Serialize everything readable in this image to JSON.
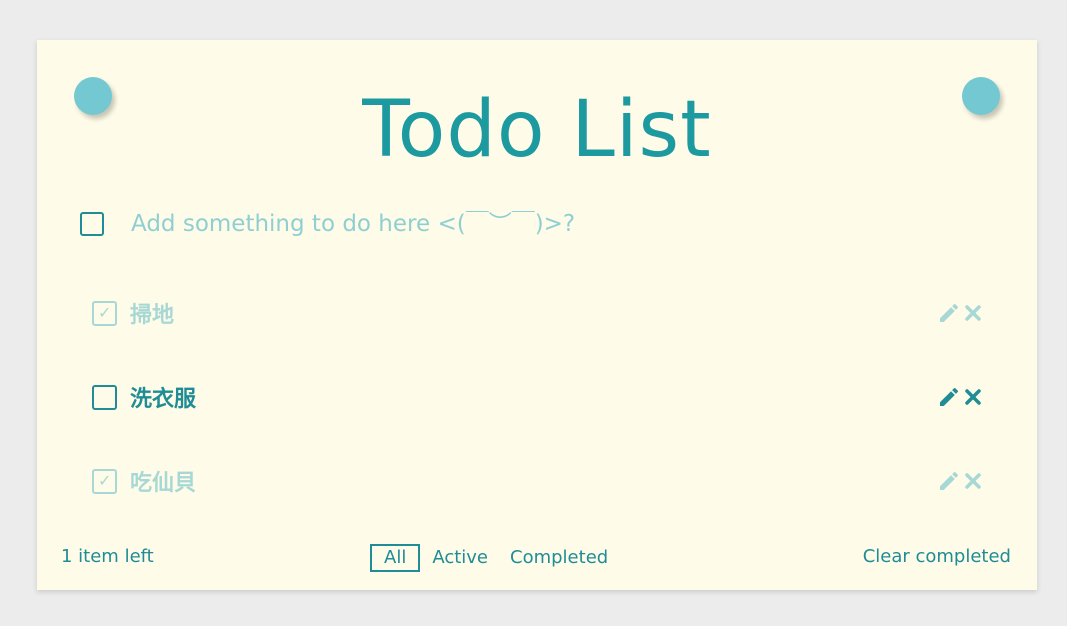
{
  "app": {
    "title": "Todo List"
  },
  "new_todo": {
    "placeholder": "Add something to do here <(￣︶￣)>?",
    "value": ""
  },
  "todos": [
    {
      "text": "掃地",
      "completed": true
    },
    {
      "text": "洗衣服",
      "completed": false
    },
    {
      "text": "吃仙貝",
      "completed": true
    }
  ],
  "icons": {
    "edit": "pencil-icon",
    "delete": "close-icon",
    "check": "check-icon"
  },
  "footer": {
    "items_left": "1 item left",
    "filters": [
      "All",
      "Active",
      "Completed"
    ],
    "selected_filter": "All",
    "clear_completed": "Clear completed"
  },
  "colors": {
    "background": "#ececec",
    "card": "#fefce8",
    "accent": "#1f8c96",
    "pin": "#74c8d2",
    "completed": "#a8d8d6",
    "placeholder": "#8fcfd3"
  }
}
